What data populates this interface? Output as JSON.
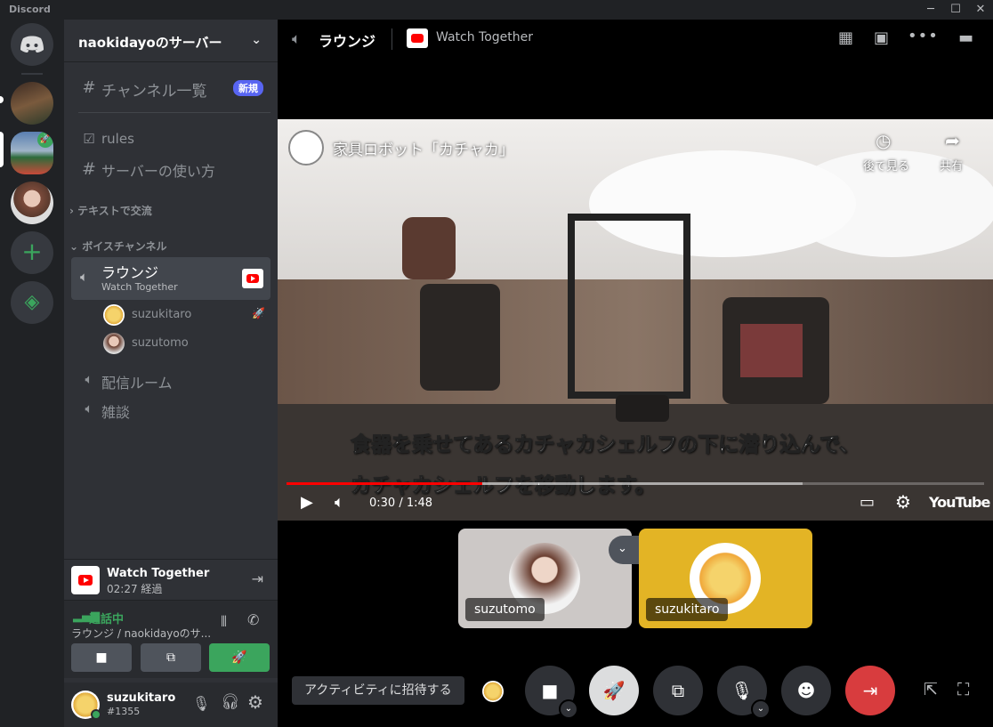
{
  "window": {
    "app_name": "Discord"
  },
  "server": {
    "name": "naokidayoのサーバー"
  },
  "sidebar": {
    "browse": {
      "label": "チャンネル一覧",
      "badge": "新規"
    },
    "channels": [
      {
        "label": "rules"
      },
      {
        "label": "サーバーの使い方"
      }
    ],
    "categories": {
      "text": "テキストで交流",
      "voice": "ボイスチャンネル"
    },
    "voice_channels": [
      {
        "label": "ラウンジ",
        "sub": "Watch Together"
      },
      {
        "label": "配信ルーム"
      },
      {
        "label": "雑談"
      }
    ],
    "voice_users": [
      {
        "name": "suzukitaro"
      },
      {
        "name": "suzutomo"
      }
    ]
  },
  "activity_panel": {
    "title": "Watch Together",
    "elapsed": "02:27 経過"
  },
  "voice_status": {
    "status": "通話中",
    "location": "ラウンジ / naokidayoのサ..."
  },
  "user": {
    "name": "suzukitaro",
    "tag": "#1355"
  },
  "main_header": {
    "channel": "ラウンジ",
    "activity": "Watch Together"
  },
  "video": {
    "title": "家具ロボット「カチャカ」",
    "watch_later": "後で見る",
    "share": "共有",
    "subtitle_line1": "食器を乗せてあるカチャカシェルフの下に潜り込んで、",
    "subtitle_line2": "カチャカシェルフを移動します。",
    "time": "0:30 / 1:48",
    "brand": "YouTube",
    "progress": 0.28,
    "buffered": 0.74
  },
  "participants": [
    {
      "name": "suzutomo"
    },
    {
      "name": "suzukitaro"
    }
  ],
  "controls": {
    "invite_label": "アクティビティに招待する"
  },
  "colors": {
    "accent": "#5865f2",
    "green": "#3ba55d",
    "red": "#ed4245",
    "youtube": "#ff0000",
    "tile_yellow": "#e3b425"
  }
}
